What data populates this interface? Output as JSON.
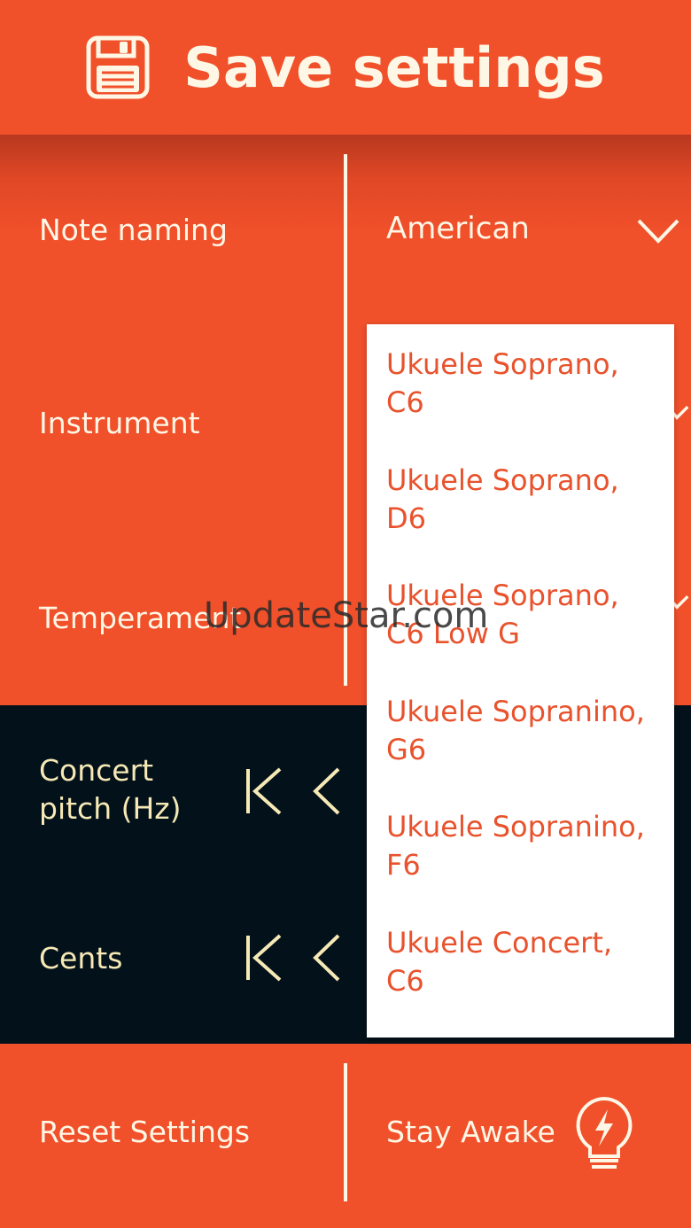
{
  "header": {
    "title": "Save settings",
    "icon": "floppy-disk-icon"
  },
  "settings": {
    "note_naming": {
      "label": "Note naming",
      "value": "American"
    },
    "instrument": {
      "label": "Instrument"
    },
    "temperament": {
      "label": "Temperament"
    }
  },
  "adjusters": {
    "concert_pitch": {
      "label_line1": "Concert",
      "label_line2": "pitch (Hz)"
    },
    "cents": {
      "label": "Cents"
    }
  },
  "instrument_options": [
    {
      "line1": "Ukuele Soprano,",
      "line2": "C6"
    },
    {
      "line1": "Ukuele Soprano,",
      "line2": "D6"
    },
    {
      "line1": "Ukuele Soprano,",
      "line2": "C6 Low G"
    },
    {
      "line1": "Ukuele Sopranino,",
      "line2": "G6"
    },
    {
      "line1": "Ukuele Sopranino,",
      "line2": "F6"
    },
    {
      "line1": "Ukuele Concert,",
      "line2": "C6"
    }
  ],
  "footer": {
    "reset_label": "Reset Settings",
    "stay_awake_label": "Stay Awake",
    "stay_awake_icon": "lightbulb-icon"
  },
  "watermark": "UpdateStar.com",
  "colors": {
    "accent": "#f0502a",
    "dark": "#03111a",
    "cream": "#fff7e6",
    "item_text": "#e8522c"
  }
}
